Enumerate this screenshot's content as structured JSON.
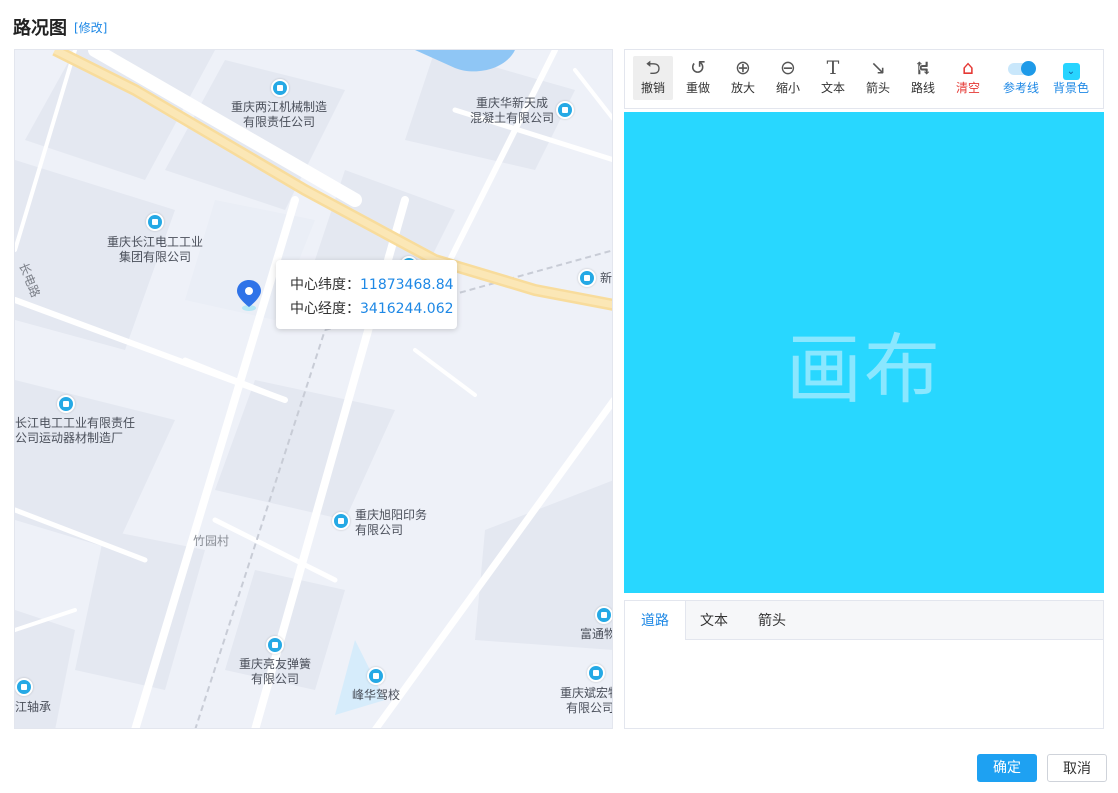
{
  "header": {
    "title": "路况图",
    "edit_link": "[修改]"
  },
  "map": {
    "tooltip": {
      "lat_label": "中心纬度：",
      "lat_value": "11873468.84",
      "lng_label": "中心经度：",
      "lng_value": "3416244.062"
    },
    "pois": [
      {
        "line1": "重庆两江机械制造",
        "line2": "有限责任公司"
      },
      {
        "line1": "重庆华新天成",
        "line2": "混凝土有限公司"
      },
      {
        "line1": "重庆长江电工工业",
        "line2": "集团有限公司"
      },
      {
        "line1": "新"
      },
      {
        "line1": "长江电工工业有限责任",
        "line2": "公司运动器材制造厂"
      },
      {
        "line1": "重庆旭阳印务",
        "line2": "有限公司"
      },
      {
        "line1": "竹园村"
      },
      {
        "line1": "富通物"
      },
      {
        "line1": "重庆亮友弹簧",
        "line2": "有限公司"
      },
      {
        "line1": "峰华驾校"
      },
      {
        "line1": "重庆斌宏物",
        "line2": "有限公司"
      },
      {
        "line1": "江轴承"
      }
    ],
    "street_label": "长电路"
  },
  "toolbar": {
    "items": [
      {
        "label": "撤销",
        "icon": "undo-icon"
      },
      {
        "label": "重做",
        "icon": "redo-icon"
      },
      {
        "label": "放大",
        "icon": "zoom-in-icon"
      },
      {
        "label": "缩小",
        "icon": "zoom-out-icon"
      },
      {
        "label": "文本",
        "icon": "text-icon"
      },
      {
        "label": "箭头",
        "icon": "arrow-icon"
      },
      {
        "label": "路线",
        "icon": "route-icon"
      },
      {
        "label": "清空",
        "icon": "clear-icon"
      },
      {
        "label": "参考线",
        "icon": "toggle-icon"
      },
      {
        "label": "背景色",
        "icon": "color-picker-icon"
      }
    ]
  },
  "canvas": {
    "label": "画布",
    "color": "#28d7ff"
  },
  "tabs": [
    {
      "label": "道路"
    },
    {
      "label": "文本"
    },
    {
      "label": "箭头"
    }
  ],
  "footer": {
    "confirm": "确定",
    "cancel": "取消"
  },
  "colors": {
    "accent": "#1e88e5",
    "danger": "#e53935",
    "button": "#1ea1f2"
  }
}
